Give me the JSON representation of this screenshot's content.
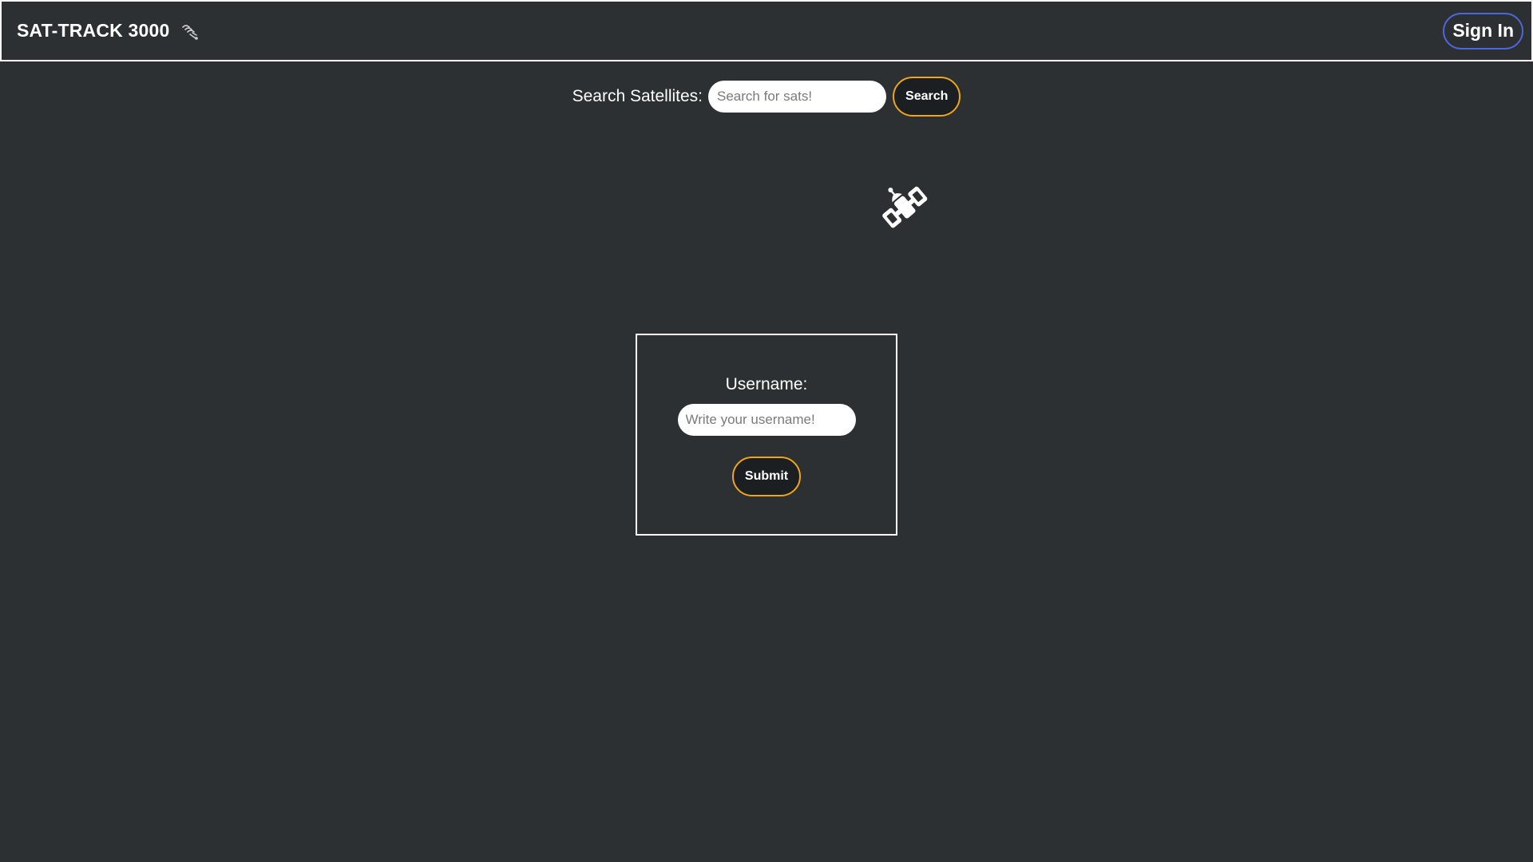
{
  "header": {
    "title": "SAT-TRACK 3000",
    "brand_icon": "satellite-dish-icon",
    "signin_label": "Sign In"
  },
  "search": {
    "label": "Search Satellites:",
    "placeholder": "Search for sats!",
    "button_label": "Search"
  },
  "hero": {
    "icon": "satellite-icon"
  },
  "login": {
    "label": "Username:",
    "placeholder": "Write your username!",
    "submit_label": "Submit"
  },
  "colors": {
    "background": "#2c3033",
    "accent_orange": "#f0a51c",
    "accent_blue": "#4f66d9",
    "text": "#ffffff"
  }
}
